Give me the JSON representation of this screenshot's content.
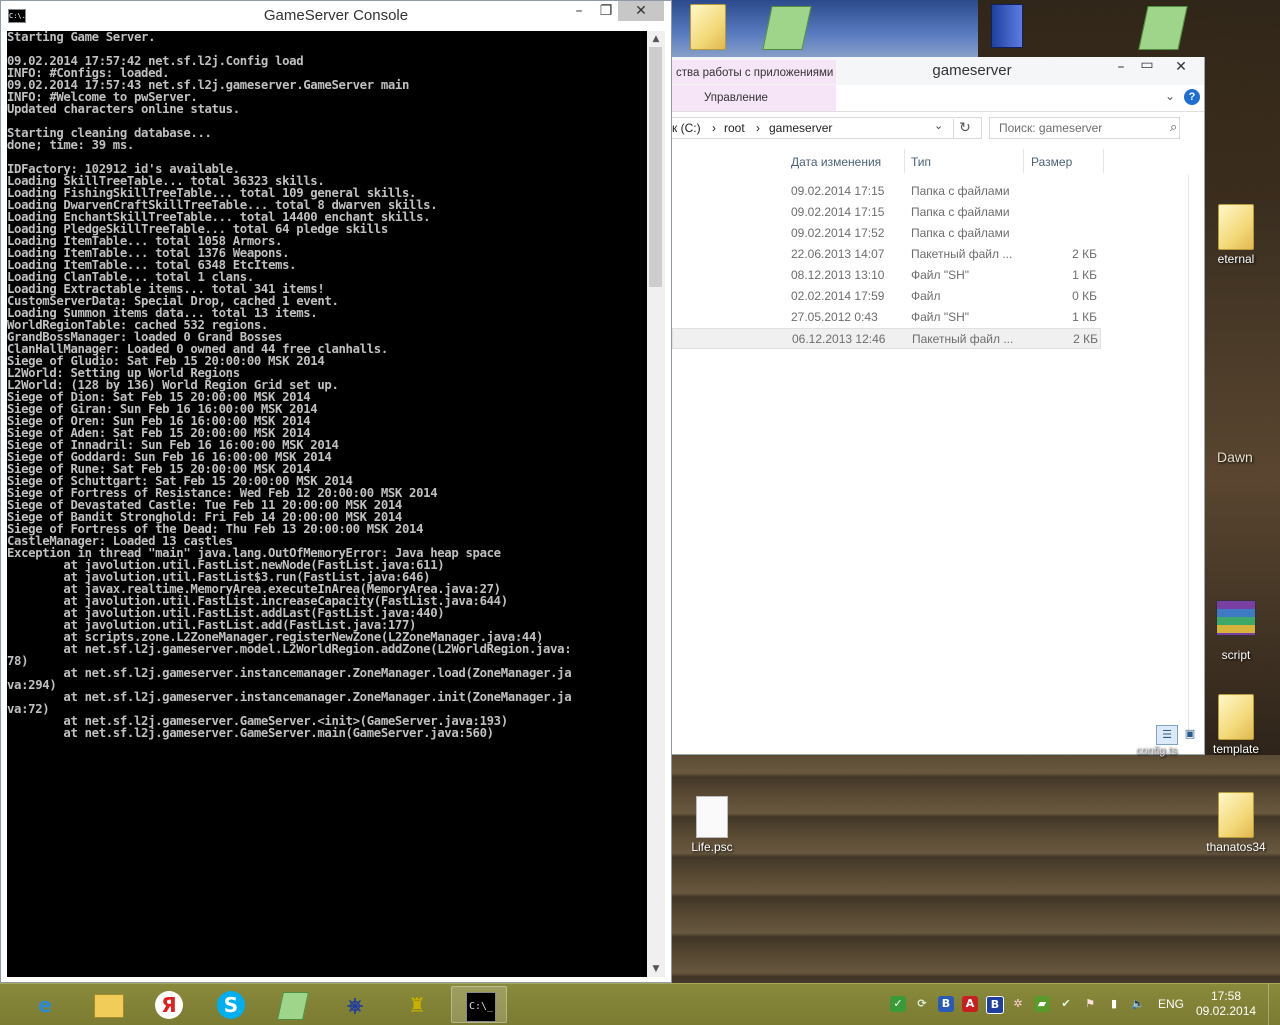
{
  "console": {
    "title": "GameServer Console",
    "controls": {
      "minimize": "–",
      "maximize": "❐",
      "close": "✕"
    },
    "icon_text": "C:\\.",
    "lines": [
      "Starting Game Server.",
      "",
      "09.02.2014 17:57:42 net.sf.l2j.Config load",
      "INFO: #Configs: loaded.",
      "09.02.2014 17:57:43 net.sf.l2j.gameserver.GameServer main",
      "INFO: #Welcome to pwServer.",
      "Updated characters online status.",
      "",
      "Starting cleaning database...",
      "done; time: 39 ms.",
      "",
      "IDFactory: 102912 id's available.",
      "Loading SkillTreeTable... total 36323 skills.",
      "Loading FishingSkillTreeTable... total 109 general skills.",
      "Loading DwarvenCraftSkillTreeTable... total 8 dwarven skills.",
      "Loading EnchantSkillTreeTable... total 14400 enchant skills.",
      "Loading PledgeSkillTreeTable... total 64 pledge skills",
      "Loading ItemTable... total 1058 Armors.",
      "Loading ItemTable... total 1376 Weapons.",
      "Loading ItemTable... total 6348 EtcItems.",
      "Loading ClanTable... total 1 clans.",
      "Loading Extractable items... total 341 items!",
      "CustomServerData: Special Drop, cached 1 event.",
      "Loading Summon items data... total 13 items.",
      "WorldRegionTable: cached 532 regions.",
      "GrandBossManager: loaded 0 Grand Bosses",
      "ClanHallManager: Loaded 0 owned and 44 free clanhalls.",
      "Siege of Gludio: Sat Feb 15 20:00:00 MSK 2014",
      "L2World: Setting up World Regions",
      "L2World: (128 by 136) World Region Grid set up.",
      "Siege of Dion: Sat Feb 15 20:00:00 MSK 2014",
      "Siege of Giran: Sun Feb 16 16:00:00 MSK 2014",
      "Siege of Oren: Sun Feb 16 16:00:00 MSK 2014",
      "Siege of Aden: Sat Feb 15 20:00:00 MSK 2014",
      "Siege of Innadril: Sun Feb 16 16:00:00 MSK 2014",
      "Siege of Goddard: Sun Feb 16 16:00:00 MSK 2014",
      "Siege of Rune: Sat Feb 15 20:00:00 MSK 2014",
      "Siege of Schuttgart: Sat Feb 15 20:00:00 MSK 2014",
      "Siege of Fortress of Resistance: Wed Feb 12 20:00:00 MSK 2014",
      "Siege of Devastated Castle: Tue Feb 11 20:00:00 MSK 2014",
      "Siege of Bandit Stronghold: Fri Feb 14 20:00:00 MSK 2014",
      "Siege of Fortress of the Dead: Thu Feb 13 20:00:00 MSK 2014",
      "CastleManager: Loaded 13 castles",
      "Exception in thread \"main\" java.lang.OutOfMemoryError: Java heap space",
      "        at javolution.util.FastList.newNode(FastList.java:611)",
      "        at javolution.util.FastList$3.run(FastList.java:646)",
      "        at javax.realtime.MemoryArea.executeInArea(MemoryArea.java:27)",
      "        at javolution.util.FastList.increaseCapacity(FastList.java:644)",
      "        at javolution.util.FastList.addLast(FastList.java:440)",
      "        at javolution.util.FastList.add(FastList.java:177)",
      "        at scripts.zone.L2ZoneManager.registerNewZone(L2ZoneManager.java:44)",
      "        at net.sf.l2j.gameserver.model.L2WorldRegion.addZone(L2WorldRegion.java:",
      "78)",
      "        at net.sf.l2j.gameserver.instancemanager.ZoneManager.load(ZoneManager.ja",
      "va:294)",
      "        at net.sf.l2j.gameserver.instancemanager.ZoneManager.init(ZoneManager.ja",
      "va:72)",
      "        at net.sf.l2j.gameserver.GameServer.<init>(GameServer.java:193)",
      "        at net.sf.l2j.gameserver.GameServer.main(GameServer.java:560)"
    ],
    "scroll_position": 0.0
  },
  "explorer": {
    "title": "gameserver",
    "contextual_tab": "ства работы с приложениями",
    "ribbon_tab": "Управление",
    "address": {
      "drive": "к (C:)",
      "sep": "›",
      "p1": "root",
      "p2": "gameserver"
    },
    "search_placeholder": "Поиск: gameserver",
    "columns": {
      "date": "Дата изменения",
      "type": "Тип",
      "size": "Размер"
    },
    "rows": [
      {
        "date": "09.02.2014 17:15",
        "type": "Папка с файлами",
        "size": ""
      },
      {
        "date": "09.02.2014 17:15",
        "type": "Папка с файлами",
        "size": ""
      },
      {
        "date": "09.02.2014 17:52",
        "type": "Папка с файлами",
        "size": ""
      },
      {
        "date": "22.06.2013 14:07",
        "type": "Пакетный файл ...",
        "size": "2 КБ"
      },
      {
        "date": "08.12.2013 13:10",
        "type": "Файл \"SH\"",
        "size": "1 КБ"
      },
      {
        "date": "02.02.2014 17:59",
        "type": "Файл",
        "size": "0 КБ"
      },
      {
        "date": "27.05.2012 0:43",
        "type": "Файл \"SH\"",
        "size": "1 КБ"
      },
      {
        "date": "06.12.2013 12:46",
        "type": "Пакетный файл ...",
        "size": "2 КБ"
      }
    ],
    "selected_row": 7
  },
  "desktop": {
    "icons": [
      {
        "name": "eternal"
      },
      {
        "name": "script"
      },
      {
        "name": "template"
      },
      {
        "name": "thanatos34"
      },
      {
        "name": "Life.psc"
      }
    ],
    "wallpaper_text": "Dawn",
    "partial_label": "config.ts"
  },
  "taskbar": {
    "lang": "ENG",
    "time": "17:58",
    "date": "09.02.2014",
    "pinned": [
      "internet-explorer",
      "file-explorer",
      "yandex-browser",
      "skype",
      "notepad-plus-plus",
      "network-tool",
      "game-launcher",
      "command-prompt"
    ]
  }
}
